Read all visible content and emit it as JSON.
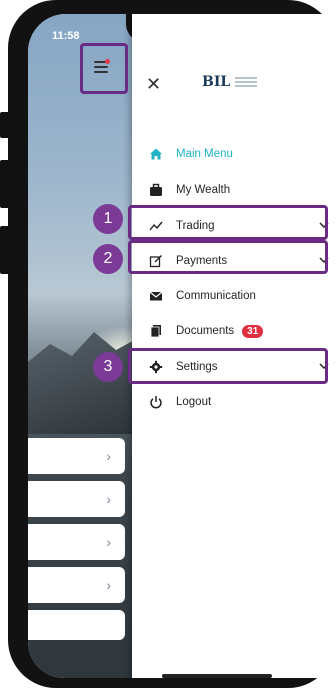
{
  "status_bar": {
    "time": "11:58",
    "icons": "··· ◠ ▬"
  },
  "logo": {
    "text": "BIL"
  },
  "menu": {
    "items": [
      {
        "label": "Main Menu",
        "icon": "home-icon",
        "active": true
      },
      {
        "label": "My Wealth",
        "icon": "briefcase-icon"
      },
      {
        "label": "Trading",
        "icon": "trend-line-icon",
        "expandable": true
      },
      {
        "label": "Payments",
        "icon": "edit-square-icon",
        "expandable": true
      },
      {
        "label": "Communication",
        "icon": "envelope-icon"
      },
      {
        "label": "Documents",
        "icon": "documents-icon",
        "badge": "31"
      },
      {
        "label": "Settings",
        "icon": "gear-icon",
        "expandable": true
      },
      {
        "label": "Logout",
        "icon": "power-icon"
      }
    ]
  },
  "left_list": {
    "chevron": "›"
  },
  "annotations": [
    "1",
    "2",
    "3"
  ],
  "colors": {
    "active": "#1fb3c6",
    "annotation": "#6a2b84",
    "badge": "#e02f3e",
    "notification_dot": "#e5374a"
  }
}
